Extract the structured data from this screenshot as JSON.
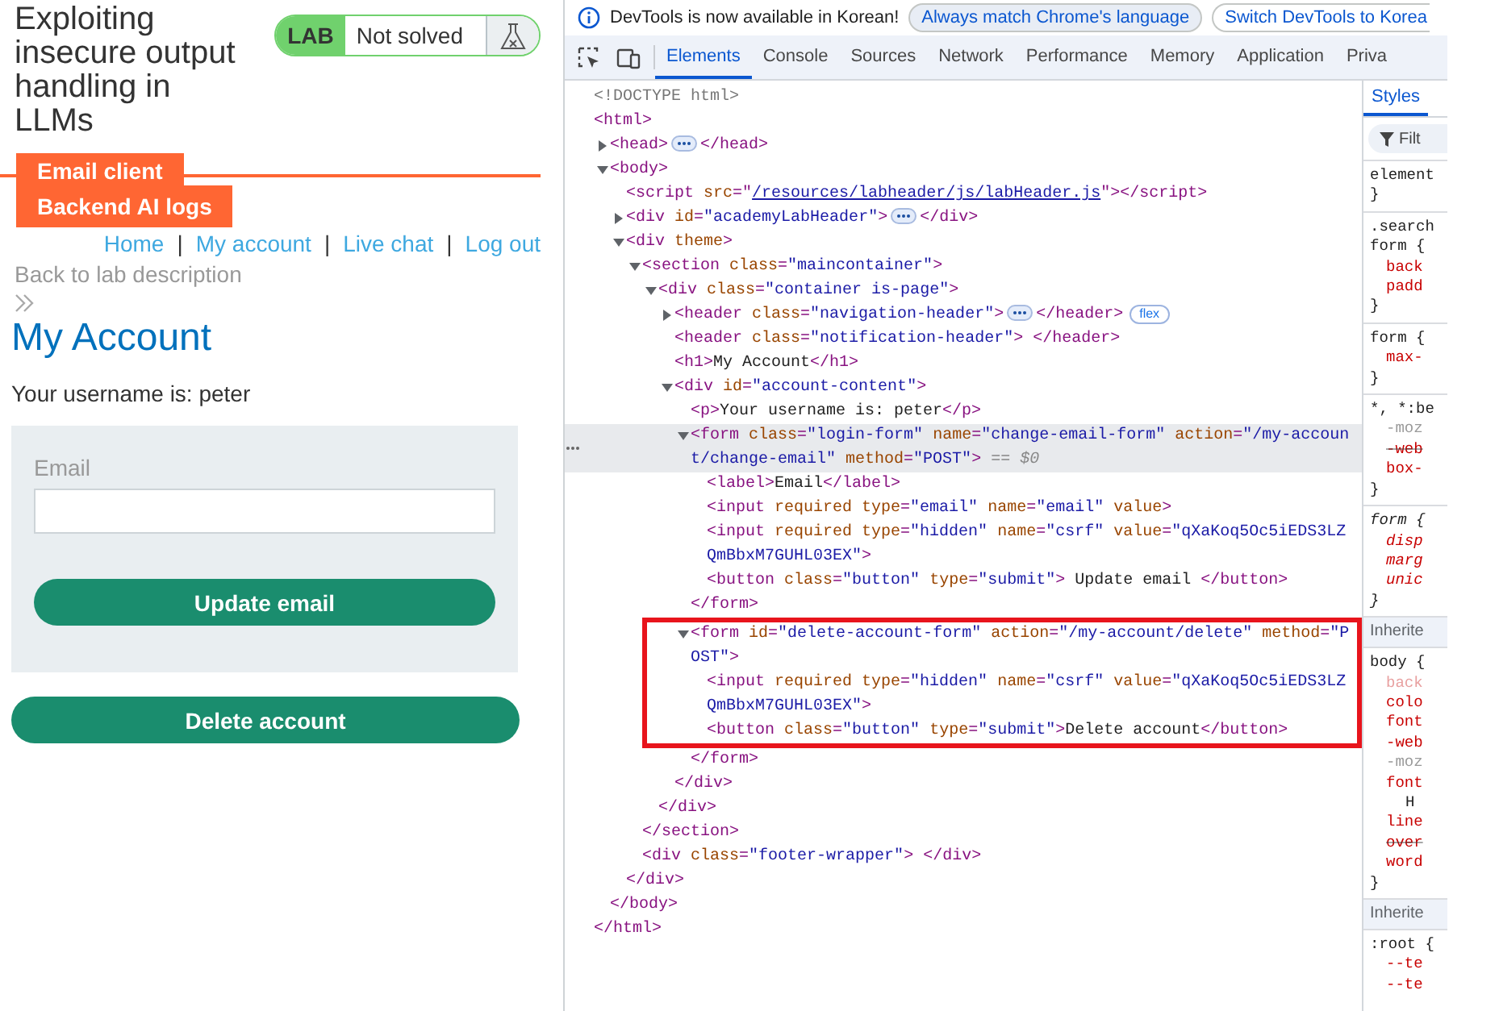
{
  "lab_page": {
    "title": "Exploiting insecure output handling in LLMs",
    "lab_badge": {
      "label": "LAB",
      "status": "Not solved"
    },
    "tabs": [
      {
        "label": "Email client"
      },
      {
        "label": "Backend AI logs"
      }
    ],
    "nav": [
      {
        "kind": "link",
        "text": "Home"
      },
      {
        "kind": "separator",
        "text": "|"
      },
      {
        "kind": "link",
        "text": "My account"
      },
      {
        "kind": "separator",
        "text": "|"
      },
      {
        "kind": "link",
        "text": "Live chat"
      },
      {
        "kind": "separator",
        "text": "|"
      },
      {
        "kind": "link",
        "text": "Log out"
      }
    ],
    "back_link": "Back to lab description",
    "heading": "My Account",
    "username_text": "Your username is: peter",
    "email_form": {
      "label": "Email",
      "button": "Update email"
    },
    "delete_button": "Delete account"
  },
  "devtools": {
    "infobar": {
      "message": "DevTools is now available in Korean!",
      "buttons": [
        "Always match Chrome's language",
        "Switch DevTools to Korea"
      ]
    },
    "tabs": [
      {
        "label": "Elements",
        "selected": true
      },
      {
        "label": "Console",
        "selected": false
      },
      {
        "label": "Sources",
        "selected": false
      },
      {
        "label": "Network",
        "selected": false
      },
      {
        "label": "Performance",
        "selected": false
      },
      {
        "label": "Memory",
        "selected": false
      },
      {
        "label": "Application",
        "selected": false
      },
      {
        "label": "Priva",
        "selected": false
      }
    ],
    "dom_tree": [
      {
        "tokens": [
          {
            "kind": "doctype",
            "text": "<!DOCTYPE html>"
          }
        ],
        "selected": false,
        "outlined": false
      },
      {
        "tokens": [
          {
            "kind": "tag",
            "text": "<html>"
          }
        ],
        "selected": false,
        "outlined": false,
        "closing": [
          {
            "kind": "tag",
            "text": "</html>"
          }
        ],
        "children": [
          {
            "tokens": [
              {
                "kind": "tag",
                "text": "<head>"
              },
              {
                "kind": "ellipsis"
              },
              {
                "kind": "tag",
                "text": "</head>"
              }
            ],
            "expanded": false,
            "selected": false,
            "outlined": false
          },
          {
            "tokens": [
              {
                "kind": "tag",
                "text": "<body>"
              }
            ],
            "expanded": true,
            "selected": false,
            "outlined": false,
            "closing": [
              {
                "kind": "tag",
                "text": "</body>"
              }
            ],
            "children": [
              {
                "tokens": [
                  {
                    "kind": "tag",
                    "text": "<script"
                  },
                  {
                    "kind": "attr",
                    "text": " src"
                  },
                  {
                    "kind": "tag",
                    "text": "=\""
                  },
                  {
                    "kind": "link",
                    "text": "/resources/labheader/js/labHeader.js"
                  },
                  {
                    "kind": "tag",
                    "text": "\"></script>"
                  }
                ],
                "selected": false,
                "outlined": false
              },
              {
                "tokens": [
                  {
                    "kind": "tag",
                    "text": "<div"
                  },
                  {
                    "kind": "attr",
                    "text": " id"
                  },
                  {
                    "kind": "tag",
                    "text": "="
                  },
                  {
                    "kind": "value",
                    "text": "\"academyLabHeader\""
                  },
                  {
                    "kind": "tag",
                    "text": ">"
                  },
                  {
                    "kind": "ellipsis"
                  },
                  {
                    "kind": "tag",
                    "text": "</div>"
                  }
                ],
                "expanded": false,
                "selected": false,
                "outlined": false
              },
              {
                "tokens": [
                  {
                    "kind": "tag",
                    "text": "<div"
                  },
                  {
                    "kind": "attr",
                    "text": " theme"
                  },
                  {
                    "kind": "tag",
                    "text": ">"
                  }
                ],
                "expanded": true,
                "selected": false,
                "outlined": false,
                "closing": [
                  {
                    "kind": "tag",
                    "text": "</div>"
                  }
                ],
                "children": [
                  {
                    "tokens": [
                      {
                        "kind": "tag",
                        "text": "<section"
                      },
                      {
                        "kind": "attr",
                        "text": " class"
                      },
                      {
                        "kind": "tag",
                        "text": "="
                      },
                      {
                        "kind": "value",
                        "text": "\"maincontainer\""
                      },
                      {
                        "kind": "tag",
                        "text": ">"
                      }
                    ],
                    "expanded": true,
                    "selected": false,
                    "outlined": false,
                    "closing": [
                      {
                        "kind": "tag",
                        "text": "</section>"
                      }
                    ],
                    "children": [
                      {
                        "tokens": [
                          {
                            "kind": "tag",
                            "text": "<div"
                          },
                          {
                            "kind": "attr",
                            "text": " class"
                          },
                          {
                            "kind": "tag",
                            "text": "="
                          },
                          {
                            "kind": "value",
                            "text": "\"container is-page\""
                          },
                          {
                            "kind": "tag",
                            "text": ">"
                          }
                        ],
                        "expanded": true,
                        "selected": false,
                        "outlined": false,
                        "closing": [
                          {
                            "kind": "tag",
                            "text": "</div>"
                          }
                        ],
                        "children": [
                          {
                            "tokens": [
                              {
                                "kind": "tag",
                                "text": "<header"
                              },
                              {
                                "kind": "attr",
                                "text": " class"
                              },
                              {
                                "kind": "tag",
                                "text": "="
                              },
                              {
                                "kind": "value",
                                "text": "\"navigation-header\""
                              },
                              {
                                "kind": "tag",
                                "text": ">"
                              },
                              {
                                "kind": "ellipsis"
                              },
                              {
                                "kind": "tag",
                                "text": "</header>"
                              },
                              {
                                "kind": "badge",
                                "text": "flex"
                              }
                            ],
                            "expanded": false,
                            "selected": false,
                            "outlined": false
                          },
                          {
                            "tokens": [
                              {
                                "kind": "tag",
                                "text": "<header"
                              },
                              {
                                "kind": "attr",
                                "text": " class"
                              },
                              {
                                "kind": "tag",
                                "text": "="
                              },
                              {
                                "kind": "value",
                                "text": "\"notification-header\""
                              },
                              {
                                "kind": "tag",
                                "text": "> </header>"
                              }
                            ],
                            "selected": false,
                            "outlined": false
                          },
                          {
                            "tokens": [
                              {
                                "kind": "tag",
                                "text": "<h1>"
                              },
                              {
                                "kind": "text",
                                "text": "My Account"
                              },
                              {
                                "kind": "tag",
                                "text": "</h1>"
                              }
                            ],
                            "selected": false,
                            "outlined": false
                          },
                          {
                            "tokens": [
                              {
                                "kind": "tag",
                                "text": "<div"
                              },
                              {
                                "kind": "attr",
                                "text": " id"
                              },
                              {
                                "kind": "tag",
                                "text": "="
                              },
                              {
                                "kind": "value",
                                "text": "\"account-content\""
                              },
                              {
                                "kind": "tag",
                                "text": ">"
                              }
                            ],
                            "expanded": true,
                            "selected": false,
                            "outlined": false,
                            "closing": [
                              {
                                "kind": "tag",
                                "text": "</div>"
                              }
                            ],
                            "children": [
                              {
                                "tokens": [
                                  {
                                    "kind": "tag",
                                    "text": "<p>"
                                  },
                                  {
                                    "kind": "text",
                                    "text": "Your username is: peter"
                                  },
                                  {
                                    "kind": "tag",
                                    "text": "</p>"
                                  }
                                ],
                                "selected": false,
                                "outlined": false
                              },
                              {
                                "tokens": [
                                  {
                                    "kind": "tag",
                                    "text": "<form"
                                  },
                                  {
                                    "kind": "attr",
                                    "text": " class"
                                  },
                                  {
                                    "kind": "tag",
                                    "text": "="
                                  },
                                  {
                                    "kind": "value",
                                    "text": "\"login-form\""
                                  },
                                  {
                                    "kind": "attr",
                                    "text": " name"
                                  },
                                  {
                                    "kind": "tag",
                                    "text": "="
                                  },
                                  {
                                    "kind": "value",
                                    "text": "\"change-email-form\""
                                  },
                                  {
                                    "kind": "attr",
                                    "text": " action"
                                  },
                                  {
                                    "kind": "tag",
                                    "text": "="
                                  },
                                  {
                                    "kind": "value",
                                    "text": "\"/my-account/change-email\""
                                  },
                                  {
                                    "kind": "attr",
                                    "text": " method"
                                  },
                                  {
                                    "kind": "tag",
                                    "text": "="
                                  },
                                  {
                                    "kind": "value",
                                    "text": "\"POST\""
                                  },
                                  {
                                    "kind": "tag",
                                    "text": ">"
                                  },
                                  {
                                    "kind": "ref",
                                    "text": " == $0"
                                  }
                                ],
                                "expanded": true,
                                "selected": true,
                                "outlined": false,
                                "closing": [
                                  {
                                    "kind": "tag",
                                    "text": "</form>"
                                  }
                                ],
                                "children": [
                                  {
                                    "tokens": [
                                      {
                                        "kind": "tag",
                                        "text": "<label>"
                                      },
                                      {
                                        "kind": "text",
                                        "text": "Email"
                                      },
                                      {
                                        "kind": "tag",
                                        "text": "</label>"
                                      }
                                    ],
                                    "selected": false,
                                    "outlined": false
                                  },
                                  {
                                    "tokens": [
                                      {
                                        "kind": "tag",
                                        "text": "<input"
                                      },
                                      {
                                        "kind": "attr",
                                        "text": " required type"
                                      },
                                      {
                                        "kind": "tag",
                                        "text": "="
                                      },
                                      {
                                        "kind": "value",
                                        "text": "\"email\""
                                      },
                                      {
                                        "kind": "attr",
                                        "text": " name"
                                      },
                                      {
                                        "kind": "tag",
                                        "text": "="
                                      },
                                      {
                                        "kind": "value",
                                        "text": "\"email\""
                                      },
                                      {
                                        "kind": "attr",
                                        "text": " value"
                                      },
                                      {
                                        "kind": "tag",
                                        "text": ">"
                                      }
                                    ],
                                    "selected": false,
                                    "outlined": false
                                  },
                                  {
                                    "tokens": [
                                      {
                                        "kind": "tag",
                                        "text": "<input"
                                      },
                                      {
                                        "kind": "attr",
                                        "text": " required type"
                                      },
                                      {
                                        "kind": "tag",
                                        "text": "="
                                      },
                                      {
                                        "kind": "value",
                                        "text": "\"hidden\""
                                      },
                                      {
                                        "kind": "attr",
                                        "text": " name"
                                      },
                                      {
                                        "kind": "tag",
                                        "text": "="
                                      },
                                      {
                                        "kind": "value",
                                        "text": "\"csrf\""
                                      },
                                      {
                                        "kind": "attr",
                                        "text": " value"
                                      },
                                      {
                                        "kind": "tag",
                                        "text": "="
                                      },
                                      {
                                        "kind": "value",
                                        "text": "\"qXaKoq5Oc5iEDS3LZQmBbxM7GUHL03EX\""
                                      },
                                      {
                                        "kind": "tag",
                                        "text": ">"
                                      }
                                    ],
                                    "selected": false,
                                    "outlined": false
                                  },
                                  {
                                    "tokens": [
                                      {
                                        "kind": "tag",
                                        "text": "<button"
                                      },
                                      {
                                        "kind": "attr",
                                        "text": " class"
                                      },
                                      {
                                        "kind": "tag",
                                        "text": "="
                                      },
                                      {
                                        "kind": "value",
                                        "text": "\"button\""
                                      },
                                      {
                                        "kind": "attr",
                                        "text": " type"
                                      },
                                      {
                                        "kind": "tag",
                                        "text": "="
                                      },
                                      {
                                        "kind": "value",
                                        "text": "\"submit\""
                                      },
                                      {
                                        "kind": "tag",
                                        "text": ">"
                                      },
                                      {
                                        "kind": "text",
                                        "text": " Update email "
                                      },
                                      {
                                        "kind": "tag",
                                        "text": "</button>"
                                      }
                                    ],
                                    "selected": false,
                                    "outlined": false
                                  }
                                ]
                              },
                              {
                                "tokens": [
                                  {
                                    "kind": "tag",
                                    "text": "<form"
                                  },
                                  {
                                    "kind": "attr",
                                    "text": " id"
                                  },
                                  {
                                    "kind": "tag",
                                    "text": "="
                                  },
                                  {
                                    "kind": "value",
                                    "text": "\"delete-account-form\""
                                  },
                                  {
                                    "kind": "attr",
                                    "text": " action"
                                  },
                                  {
                                    "kind": "tag",
                                    "text": "="
                                  },
                                  {
                                    "kind": "value",
                                    "text": "\"/my-account/delete\""
                                  },
                                  {
                                    "kind": "attr",
                                    "text": " method"
                                  },
                                  {
                                    "kind": "tag",
                                    "text": "="
                                  },
                                  {
                                    "kind": "value",
                                    "text": "\"POST\""
                                  },
                                  {
                                    "kind": "tag",
                                    "text": ">"
                                  }
                                ],
                                "expanded": true,
                                "selected": false,
                                "outlined": true,
                                "closing": [
                                  {
                                    "kind": "tag",
                                    "text": "</form>"
                                  }
                                ],
                                "children": [
                                  {
                                    "tokens": [
                                      {
                                        "kind": "tag",
                                        "text": "<input"
                                      },
                                      {
                                        "kind": "attr",
                                        "text": " required type"
                                      },
                                      {
                                        "kind": "tag",
                                        "text": "="
                                      },
                                      {
                                        "kind": "value",
                                        "text": "\"hidden\""
                                      },
                                      {
                                        "kind": "attr",
                                        "text": " name"
                                      },
                                      {
                                        "kind": "tag",
                                        "text": "="
                                      },
                                      {
                                        "kind": "value",
                                        "text": "\"csrf\""
                                      },
                                      {
                                        "kind": "attr",
                                        "text": " value"
                                      },
                                      {
                                        "kind": "tag",
                                        "text": "="
                                      },
                                      {
                                        "kind": "value",
                                        "text": "\"qXaKoq5Oc5iEDS3LZQmBbxM7GUHL03EX\""
                                      },
                                      {
                                        "kind": "tag",
                                        "text": ">"
                                      }
                                    ],
                                    "selected": false,
                                    "outlined": false
                                  },
                                  {
                                    "tokens": [
                                      {
                                        "kind": "tag",
                                        "text": "<button"
                                      },
                                      {
                                        "kind": "attr",
                                        "text": " class"
                                      },
                                      {
                                        "kind": "tag",
                                        "text": "="
                                      },
                                      {
                                        "kind": "value",
                                        "text": "\"button\""
                                      },
                                      {
                                        "kind": "attr",
                                        "text": " type"
                                      },
                                      {
                                        "kind": "tag",
                                        "text": "="
                                      },
                                      {
                                        "kind": "value",
                                        "text": "\"submit\""
                                      },
                                      {
                                        "kind": "tag",
                                        "text": ">"
                                      },
                                      {
                                        "kind": "text",
                                        "text": "Delete account"
                                      },
                                      {
                                        "kind": "tag",
                                        "text": "</button>"
                                      }
                                    ],
                                    "selected": false,
                                    "outlined": false
                                  }
                                ]
                              }
                            ]
                          }
                        ]
                      }
                    ]
                  },
                  {
                    "tokens": [
                      {
                        "kind": "tag",
                        "text": "<div"
                      },
                      {
                        "kind": "attr",
                        "text": " class"
                      },
                      {
                        "kind": "tag",
                        "text": "="
                      },
                      {
                        "kind": "value",
                        "text": "\"footer-wrapper\""
                      },
                      {
                        "kind": "tag",
                        "text": "> </div>"
                      }
                    ],
                    "selected": false,
                    "outlined": false
                  }
                ]
              }
            ]
          }
        ]
      }
    ],
    "styles_tabs": [
      {
        "label": "Styles",
        "selected": true
      }
    ],
    "filter": {
      "placeholder": "Filt"
    },
    "style_sections": [
      {
        "kind": "rule",
        "lines": [
          {
            "kind": "selector",
            "text": "element"
          },
          {
            "kind": "brace",
            "text": "}"
          }
        ]
      },
      {
        "kind": "rule",
        "lines": [
          {
            "kind": "selector",
            "text": ".search"
          },
          {
            "kind": "selector",
            "text": "form {"
          },
          {
            "kind": "prop",
            "text": "back"
          },
          {
            "kind": "prop",
            "text": "padd"
          },
          {
            "kind": "brace",
            "text": "}"
          }
        ]
      },
      {
        "kind": "rule",
        "lines": [
          {
            "kind": "selector",
            "text": "form {"
          },
          {
            "kind": "prop",
            "text": "max-"
          },
          {
            "kind": "brace",
            "text": "}"
          }
        ]
      },
      {
        "kind": "rule",
        "lines": [
          {
            "kind": "selector",
            "text": "*, *:be"
          },
          {
            "kind": "prop-muted",
            "text": "-moz"
          },
          {
            "kind": "prop-struck",
            "text": "-web"
          },
          {
            "kind": "prop",
            "text": "box-"
          },
          {
            "kind": "brace",
            "text": "}"
          }
        ]
      },
      {
        "kind": "ua-rule",
        "lines": [
          {
            "kind": "selector",
            "text": "form {"
          },
          {
            "kind": "prop",
            "text": "disp"
          },
          {
            "kind": "prop",
            "text": "marg"
          },
          {
            "kind": "prop",
            "text": "unic"
          },
          {
            "kind": "brace",
            "text": "}"
          }
        ]
      },
      {
        "kind": "inherited",
        "text": "Inherite"
      },
      {
        "kind": "rule",
        "lines": [
          {
            "kind": "selector",
            "text": "body {"
          },
          {
            "kind": "prop-faded",
            "text": "back"
          },
          {
            "kind": "prop",
            "text": "colo"
          },
          {
            "kind": "prop",
            "text": "font"
          },
          {
            "kind": "prop",
            "text": "-web"
          },
          {
            "kind": "prop-muted",
            "text": "-moz"
          },
          {
            "kind": "prop",
            "text": "font"
          },
          {
            "kind": "value",
            "text": "H"
          },
          {
            "kind": "prop",
            "text": "line"
          },
          {
            "kind": "prop-struck",
            "text": "over"
          },
          {
            "kind": "prop",
            "text": "word"
          },
          {
            "kind": "brace",
            "text": "}"
          }
        ]
      },
      {
        "kind": "inherited",
        "text": "Inherite"
      },
      {
        "kind": "rule",
        "lines": [
          {
            "kind": "selector",
            "text": ":root {"
          },
          {
            "kind": "prop",
            "text": "--te"
          },
          {
            "kind": "prop",
            "text": "--te"
          }
        ]
      }
    ]
  }
}
